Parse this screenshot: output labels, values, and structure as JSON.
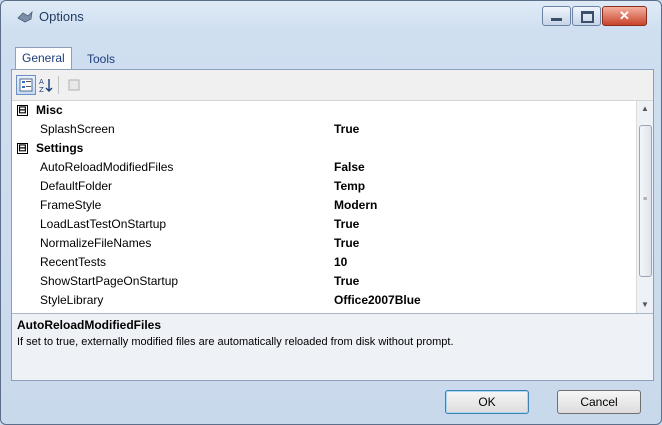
{
  "window": {
    "title": "Options"
  },
  "tabs": [
    {
      "label": "General"
    },
    {
      "label": "Tools"
    }
  ],
  "toolbar": {
    "categorized_icon": "categorized-icon",
    "alphabetical_icon": "alphabetical-icon",
    "property_pages_icon": "property-pages-icon"
  },
  "grid": {
    "categories": [
      {
        "name": "Misc",
        "expander": "⊟"
      },
      {
        "name": "Settings",
        "expander": "⊟"
      }
    ],
    "misc": [
      {
        "name": "SplashScreen",
        "value": "True"
      }
    ],
    "settings": [
      {
        "name": "AutoReloadModifiedFiles",
        "value": "False"
      },
      {
        "name": "DefaultFolder",
        "value": "Temp"
      },
      {
        "name": "FrameStyle",
        "value": "Modern"
      },
      {
        "name": "LoadLastTestOnStartup",
        "value": "True"
      },
      {
        "name": "NormalizeFileNames",
        "value": "True"
      },
      {
        "name": "RecentTests",
        "value": "10"
      },
      {
        "name": "ShowStartPageOnStartup",
        "value": "True"
      },
      {
        "name": "StyleLibrary",
        "value": "Office2007Blue"
      }
    ]
  },
  "help": {
    "title": "AutoReloadModifiedFiles",
    "text": "If set to true, externally modified files are automatically reloaded from disk without prompt."
  },
  "buttons": {
    "ok": "OK",
    "cancel": "Cancel"
  }
}
